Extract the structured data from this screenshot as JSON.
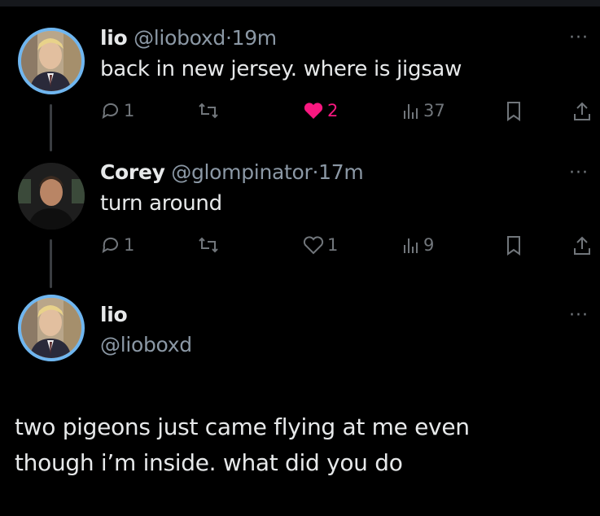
{
  "tweets": [
    {
      "name": "lio",
      "handle": "@lioboxd",
      "time": "19m",
      "text": "back in new jersey. where is jigsaw",
      "replies": "1",
      "likes": "2",
      "views": "37"
    },
    {
      "name": "Corey",
      "handle": "@glompinator",
      "time": "17m",
      "text": "turn around",
      "replies": "1",
      "likes": "1",
      "views": "9"
    }
  ],
  "main_tweet": {
    "name": "lio",
    "handle": "@lioboxd",
    "text_line1": "two pigeons just came flying at me even",
    "text_line2": "though i’m inside. what did you do"
  },
  "separator": "·",
  "more_label": "···",
  "colors": {
    "background": "#000000",
    "text": "#e7e9ea",
    "muted": "#71767b",
    "like": "#f91880",
    "avatar_ring": "#6fb6f0"
  }
}
